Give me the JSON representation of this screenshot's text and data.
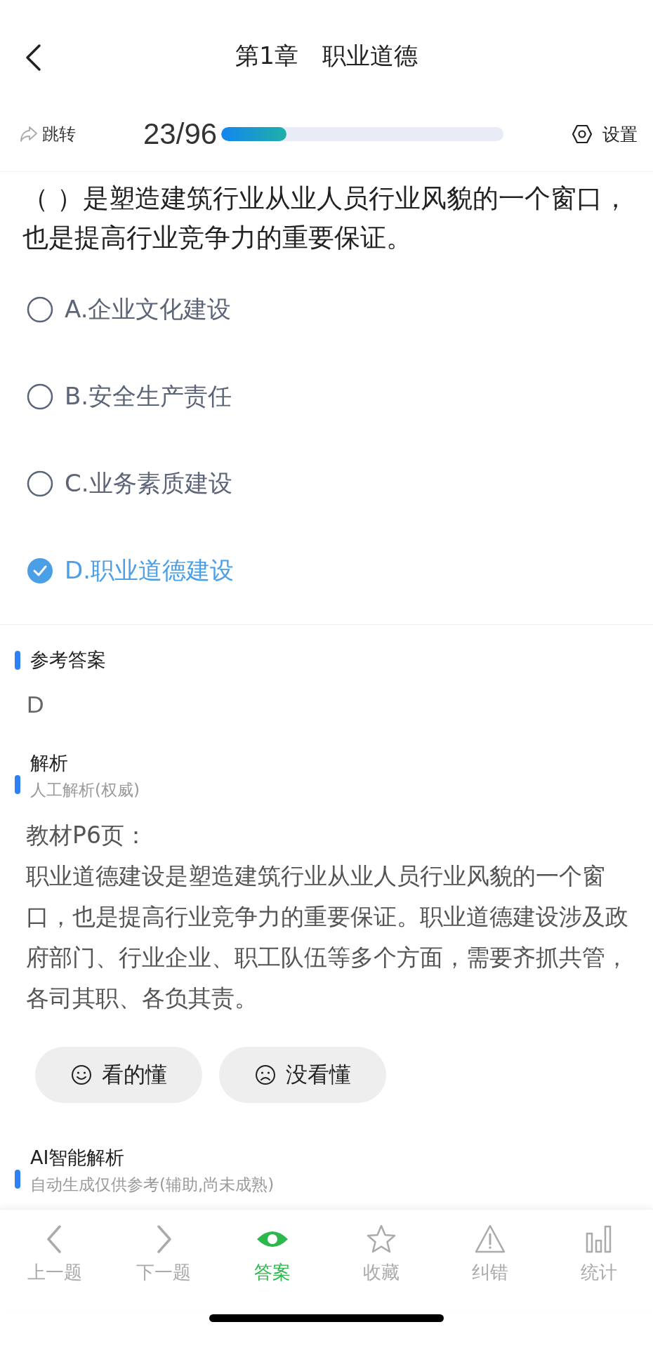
{
  "header": {
    "title": "第1章　职业道德"
  },
  "toolbar": {
    "jump": "跳转",
    "progress_text": "23/96",
    "level": 0.23,
    "settings": "设置"
  },
  "question": {
    "text": "（ ）是塑造建筑行业从业人员行业风貌的一个窗口，也是提高行业竞争力的重要保证。",
    "options": [
      {
        "label": "A.企业文化建设",
        "selected": false
      },
      {
        "label": "B.安全生产责任",
        "selected": false
      },
      {
        "label": "C.业务素质建设",
        "selected": false
      },
      {
        "label": "D.职业道德建设",
        "selected": true
      }
    ]
  },
  "answer": {
    "title": "参考答案",
    "value": "D"
  },
  "analysis": {
    "title": "解析",
    "subtitle": "人工解析(权威)",
    "lines": [
      "教材P6页：",
      "职业道德建设是塑造建筑行业从业人员行业风貌的一个窗口，也是提高行业竞争力的重要保证。职业道德建设涉及政府部门、行业企业、职工队伍等多个方面，需要齐抓共管，各司其职、各负其责。"
    ],
    "feedback": [
      {
        "kind": "happy",
        "label": "看的懂"
      },
      {
        "kind": "sad",
        "label": "没看懂"
      }
    ]
  },
  "ai_analysis": {
    "title": "AI智能解析",
    "subtitle": "自动生成仅供参考(辅助,尚未成熟)"
  },
  "tabbar": [
    {
      "kind": "prev",
      "label": "上一题",
      "selected": false
    },
    {
      "kind": "next",
      "label": "下一题",
      "selected": false
    },
    {
      "kind": "answer",
      "label": "答案",
      "selected": true
    },
    {
      "kind": "favorite",
      "label": "收藏",
      "selected": false
    },
    {
      "kind": "report",
      "label": "纠错",
      "selected": false
    },
    {
      "kind": "stats",
      "label": "统计",
      "selected": false
    }
  ]
}
